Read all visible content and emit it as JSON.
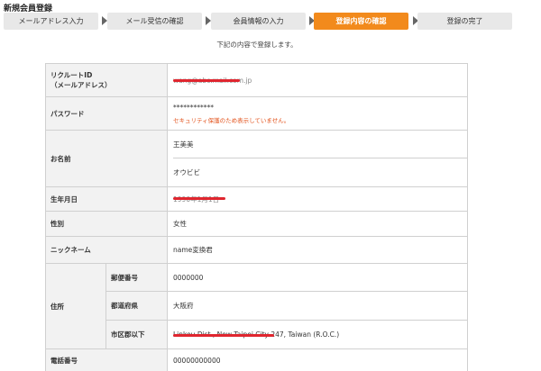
{
  "page_title": "新規会員登録",
  "steps": [
    {
      "label": "メールアドレス入力"
    },
    {
      "label": "メール受信の確認"
    },
    {
      "label": "会員情報の入力"
    },
    {
      "label": "登録内容の確認"
    },
    {
      "label": "登録の完了"
    }
  ],
  "intro": "下記の内容で登録します。",
  "rows": {
    "recruit_id": {
      "label_1": "リクルートID",
      "label_2": "（メールアドレス）",
      "value": "wang@abc.mail.com.jp"
    },
    "password": {
      "label": "パスワード",
      "value": "************",
      "note": "セキュリティ保護のため表示していません。"
    },
    "name": {
      "label": "お名前",
      "value_1": "王美美",
      "value_2": "オウビビ"
    },
    "birthday": {
      "label": "生年月日",
      "value": "1990年1月1日"
    },
    "gender": {
      "label": "性別",
      "value": "女性"
    },
    "nickname": {
      "label": "ニックネーム",
      "value": "name変換君"
    },
    "address": {
      "label": "住所",
      "postal_label": "郵便番号",
      "postal_value": "0000000",
      "prefecture_label": "都道府県",
      "prefecture_value": "大阪府",
      "city_label": "市区郡以下",
      "city_value": "Linkou Dist., New Taipei City 247, Taiwan (R.O.C.)"
    },
    "phone": {
      "label": "電話番号",
      "value": "00000000000"
    }
  },
  "colors": {
    "active_step": "#f28a1c",
    "note": "#e3541e",
    "redaction": "#e0262f"
  }
}
